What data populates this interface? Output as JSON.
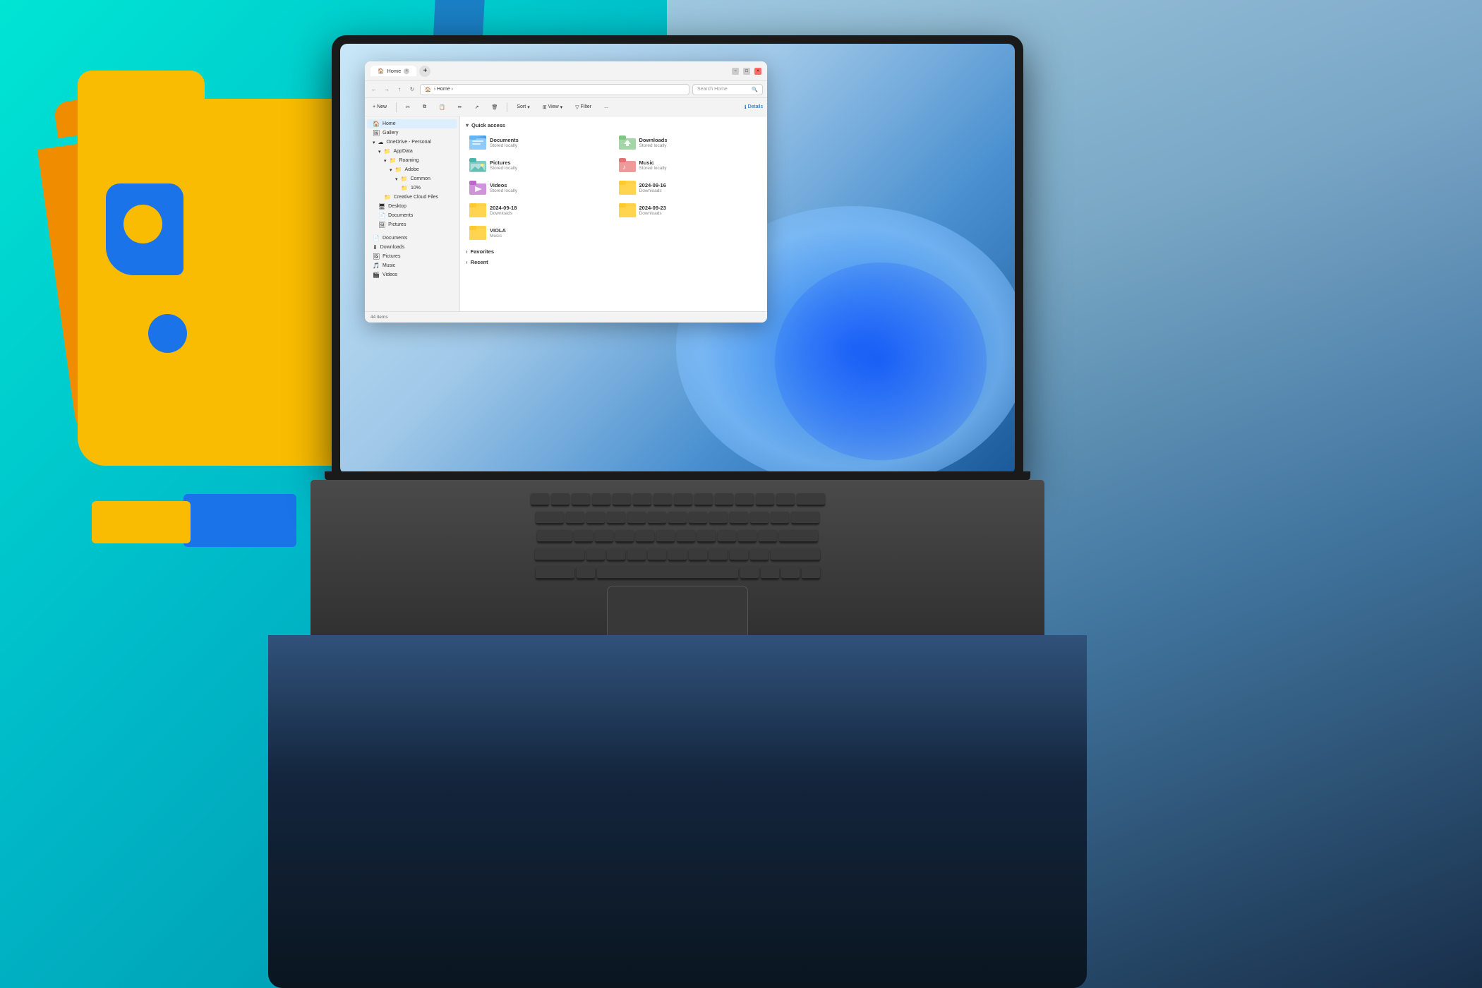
{
  "background": {
    "colors": {
      "teal": "#00c8d4",
      "blue": "#1a7fc4",
      "dark": "#0a3060"
    }
  },
  "logo": {
    "type": "Google Drive / Python composite"
  },
  "window": {
    "title": "Home",
    "tab_label": "Home",
    "close_btn": "×",
    "min_btn": "−",
    "max_btn": "□",
    "address_path": "Home",
    "search_placeholder": "Search Home",
    "toolbar": {
      "new_btn": "New",
      "cut_btn": "Cut",
      "copy_btn": "Copy",
      "paste_btn": "Paste",
      "rename_btn": "Rename",
      "share_btn": "Share",
      "delete_btn": "Delete",
      "sort_btn": "Sort",
      "view_btn": "View",
      "filter_btn": "Filter",
      "more_btn": "...",
      "details_btn": "Details"
    },
    "sidebar": {
      "items": [
        {
          "label": "Home",
          "icon": "🏠",
          "active": true,
          "indent": 0
        },
        {
          "label": "Gallery",
          "icon": "🖼",
          "active": false,
          "indent": 0
        },
        {
          "label": "OneDrive - Personal",
          "icon": "☁",
          "active": false,
          "indent": 0
        },
        {
          "label": "AppData",
          "icon": "📁",
          "active": false,
          "indent": 1
        },
        {
          "label": "Roaming",
          "icon": "📁",
          "active": false,
          "indent": 2
        },
        {
          "label": "Adobe",
          "icon": "📁",
          "active": false,
          "indent": 3
        },
        {
          "label": "Common",
          "icon": "📁",
          "active": false,
          "indent": 4
        },
        {
          "label": "10%",
          "icon": "📁",
          "active": false,
          "indent": 5
        },
        {
          "label": "Creative Cloud Files",
          "icon": "📁",
          "active": false,
          "indent": 2
        },
        {
          "label": "Desktop",
          "icon": "🖥",
          "active": false,
          "indent": 1
        },
        {
          "label": "Documents",
          "icon": "📄",
          "active": false,
          "indent": 1
        },
        {
          "label": "Pictures",
          "icon": "🖼",
          "active": false,
          "indent": 1
        },
        {
          "label": "Documents",
          "icon": "📄",
          "active": false,
          "indent": 0
        },
        {
          "label": "Downloads",
          "icon": "⬇",
          "active": false,
          "indent": 0
        },
        {
          "label": "Pictures",
          "icon": "🖼",
          "active": false,
          "indent": 0
        },
        {
          "label": "Music",
          "icon": "🎵",
          "active": false,
          "indent": 0
        },
        {
          "label": "Videos",
          "icon": "🎬",
          "active": false,
          "indent": 0
        }
      ]
    },
    "quick_access": {
      "label": "Quick access",
      "items": [
        {
          "name": "Documents",
          "sub": "Stored locally",
          "color": "blue"
        },
        {
          "name": "Downloads",
          "sub": "Stored locally",
          "color": "green"
        },
        {
          "name": "Pictures",
          "sub": "Stored locally",
          "color": "mountain"
        },
        {
          "name": "Music",
          "sub": "Stored locally",
          "color": "red"
        },
        {
          "name": "Videos",
          "sub": "Stored locally",
          "color": "purple"
        },
        {
          "name": "2024-09-16",
          "sub": "Downloads",
          "color": "yellow"
        },
        {
          "name": "2024-09-18",
          "sub": "Downloads",
          "color": "yellow"
        },
        {
          "name": "2024-09-23",
          "sub": "Downloads",
          "color": "yellow"
        },
        {
          "name": "VIOLA",
          "sub": "Music",
          "color": "yellow"
        }
      ]
    },
    "favorites": {
      "label": "Favorites"
    },
    "recent": {
      "label": "Recent"
    },
    "status_bar": {
      "item_count": "44 items"
    }
  }
}
